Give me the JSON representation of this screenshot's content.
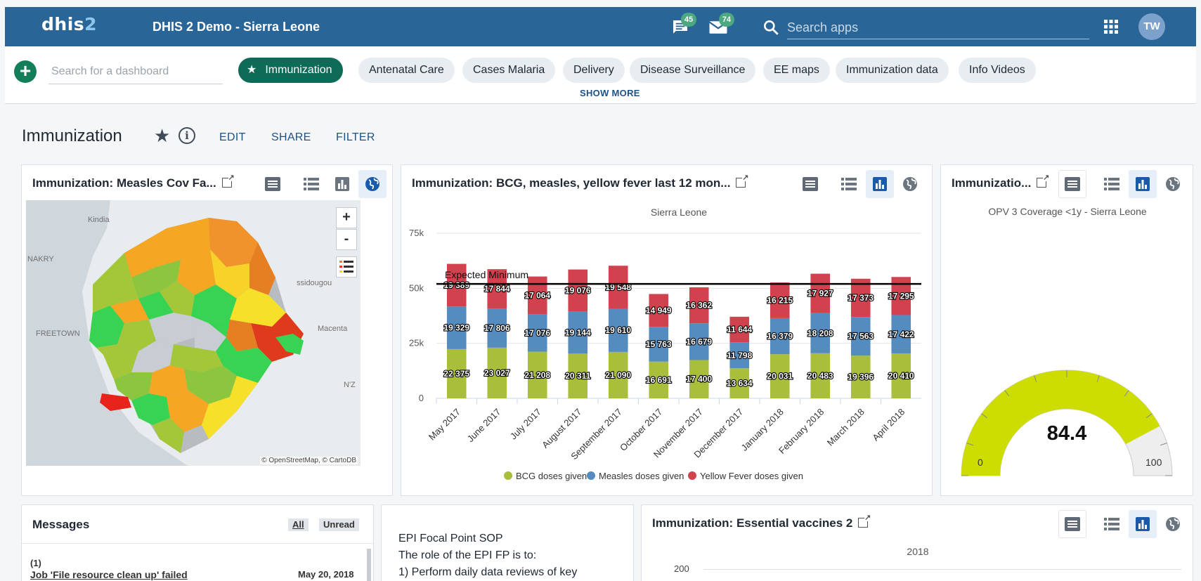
{
  "header": {
    "logo_main": "dhis",
    "logo_num": "2",
    "title": "DHIS 2 Demo - Sierra Leone",
    "messages_badge": "45",
    "interpretations_badge": "74",
    "search_placeholder": "Search apps",
    "avatar_initials": "TW"
  },
  "dashbar": {
    "add_icon": "+",
    "search_placeholder": "Search for a dashboard",
    "chips": [
      "Immunization",
      "Antenatal Care",
      "Cases Malaria",
      "Delivery",
      "Disease Surveillance",
      "EE maps",
      "Immunization data",
      "Info Videos"
    ],
    "show_more": "SHOW MORE"
  },
  "dashboard": {
    "title": "Immunization",
    "edit": "EDIT",
    "share": "SHARE",
    "filter": "FILTER"
  },
  "map_card": {
    "title": "Immunization: Measles Cov Fa...",
    "zoom_in": "+",
    "zoom_out": "-",
    "labels": [
      "Kindia",
      "NAKRY",
      "FREETOWN",
      "Macenta",
      "ssidougou",
      "N'Z"
    ],
    "attribution": "© OpenStreetMap, © CartoDB"
  },
  "bar_card": {
    "title": "Immunization: BCG, measles, yellow fever last 12 mon...",
    "subtitle": "Sierra Leone",
    "target_label": "Expected Minimum"
  },
  "gauge_card": {
    "title": "Immunizatio...",
    "subtitle": "OPV 3 Coverage <1y - Sierra Leone",
    "value_text": "84.4",
    "min_label": "0",
    "max_label": "100",
    "value": 84.4,
    "max": 100,
    "fill_color": "#cddc01"
  },
  "messages": {
    "title": "Messages",
    "filter_all": "All",
    "filter_unread": "Unread",
    "item_count": "(1)",
    "item_subject": "Job 'File resource clean up' failed",
    "item_date": "May 20, 2018"
  },
  "text_card": {
    "line1": "EPI Focal Point SOP",
    "line2": "The role of the EPI FP is to:",
    "line3": "1) Perform daily data reviews of key"
  },
  "ev_card": {
    "title": "Immunization: Essential vaccines 2",
    "subtitle": "2018",
    "ytick": "200"
  },
  "colors": {
    "header": "#2a6597",
    "bcg": "#a9be3b",
    "measles": "#558cc0",
    "yellow_fever": "#d1424e"
  },
  "chart_data": {
    "type": "bar",
    "stacked": true,
    "title": "Sierra Leone",
    "categories": [
      "May 2017",
      "June 2017",
      "July 2017",
      "August 2017",
      "September 2017",
      "October 2017",
      "November 2017",
      "December 2017",
      "January 2018",
      "February 2018",
      "March 2018",
      "April 2018"
    ],
    "series": [
      {
        "name": "BCG doses given",
        "values": [
          22375,
          23027,
          21208,
          20311,
          21090,
          16691,
          17400,
          13634,
          20031,
          20483,
          19396,
          20410
        ]
      },
      {
        "name": "Measles doses given",
        "values": [
          19329,
          17806,
          17076,
          19144,
          19610,
          15763,
          16679,
          11798,
          16379,
          18208,
          17563,
          17422
        ]
      },
      {
        "name": "Yellow Fever doses given",
        "values": [
          19389,
          17844,
          17064,
          19076,
          19548,
          14949,
          16362,
          11644,
          16215,
          17927,
          17373,
          17295
        ]
      }
    ],
    "value_labels": {
      "BCG doses given": [
        "22 375",
        "23 027",
        "21 208",
        "20 311",
        "21 090",
        "16 691",
        "17 400",
        "13 634",
        "20 031",
        "20 483",
        "19 396",
        "20 410"
      ],
      "Measles doses given": [
        "19 329",
        "17 806",
        "17 076",
        "19 144",
        "19 610",
        "15 763",
        "16 679",
        "11 798",
        "16 379",
        "18 208",
        "17 563",
        "17 422"
      ],
      "Yellow Fever doses given": [
        "19 389",
        "17 844",
        "17 064",
        "19 076",
        "19 548",
        "14 949",
        "16 362",
        "11 644",
        "16 215",
        "17 927",
        "17 373",
        "17 295"
      ]
    },
    "target_line": 52000,
    "ylim": [
      0,
      75000
    ],
    "yticks": [
      0,
      25000,
      50000,
      75000
    ],
    "ytick_labels": [
      "0",
      "25k",
      "50k",
      "75k"
    ],
    "grid": true,
    "legend": "bottom"
  }
}
